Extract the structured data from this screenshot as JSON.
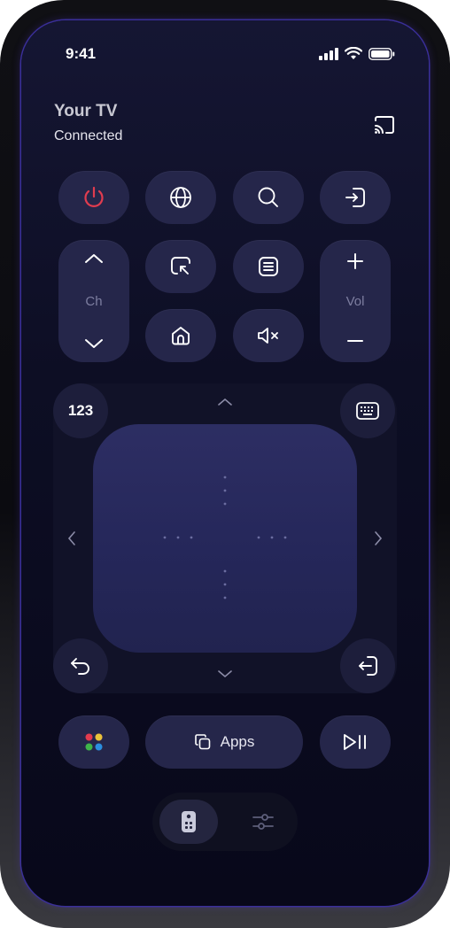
{
  "status": {
    "time": "9:41"
  },
  "header": {
    "tv_name": "Your TV",
    "status": "Connected"
  },
  "channel": {
    "label": "Ch"
  },
  "volume": {
    "label": "Vol"
  },
  "keypad": {
    "number_label": "123"
  },
  "bottom": {
    "apps_label": "Apps"
  },
  "colors": {
    "accent_power": "#e03c4f",
    "button_bg": "#25264a",
    "screen_bg": "#0d0e24"
  },
  "icons": [
    "power-icon",
    "globe-icon",
    "search-icon",
    "input-icon",
    "cast-icon",
    "screen-mirror-icon",
    "list-icon",
    "home-icon",
    "mute-icon",
    "keyboard-icon",
    "back-icon",
    "exit-icon",
    "color-dots-icon",
    "copy-icon",
    "play-pause-icon",
    "remote-icon",
    "sliders-icon"
  ]
}
